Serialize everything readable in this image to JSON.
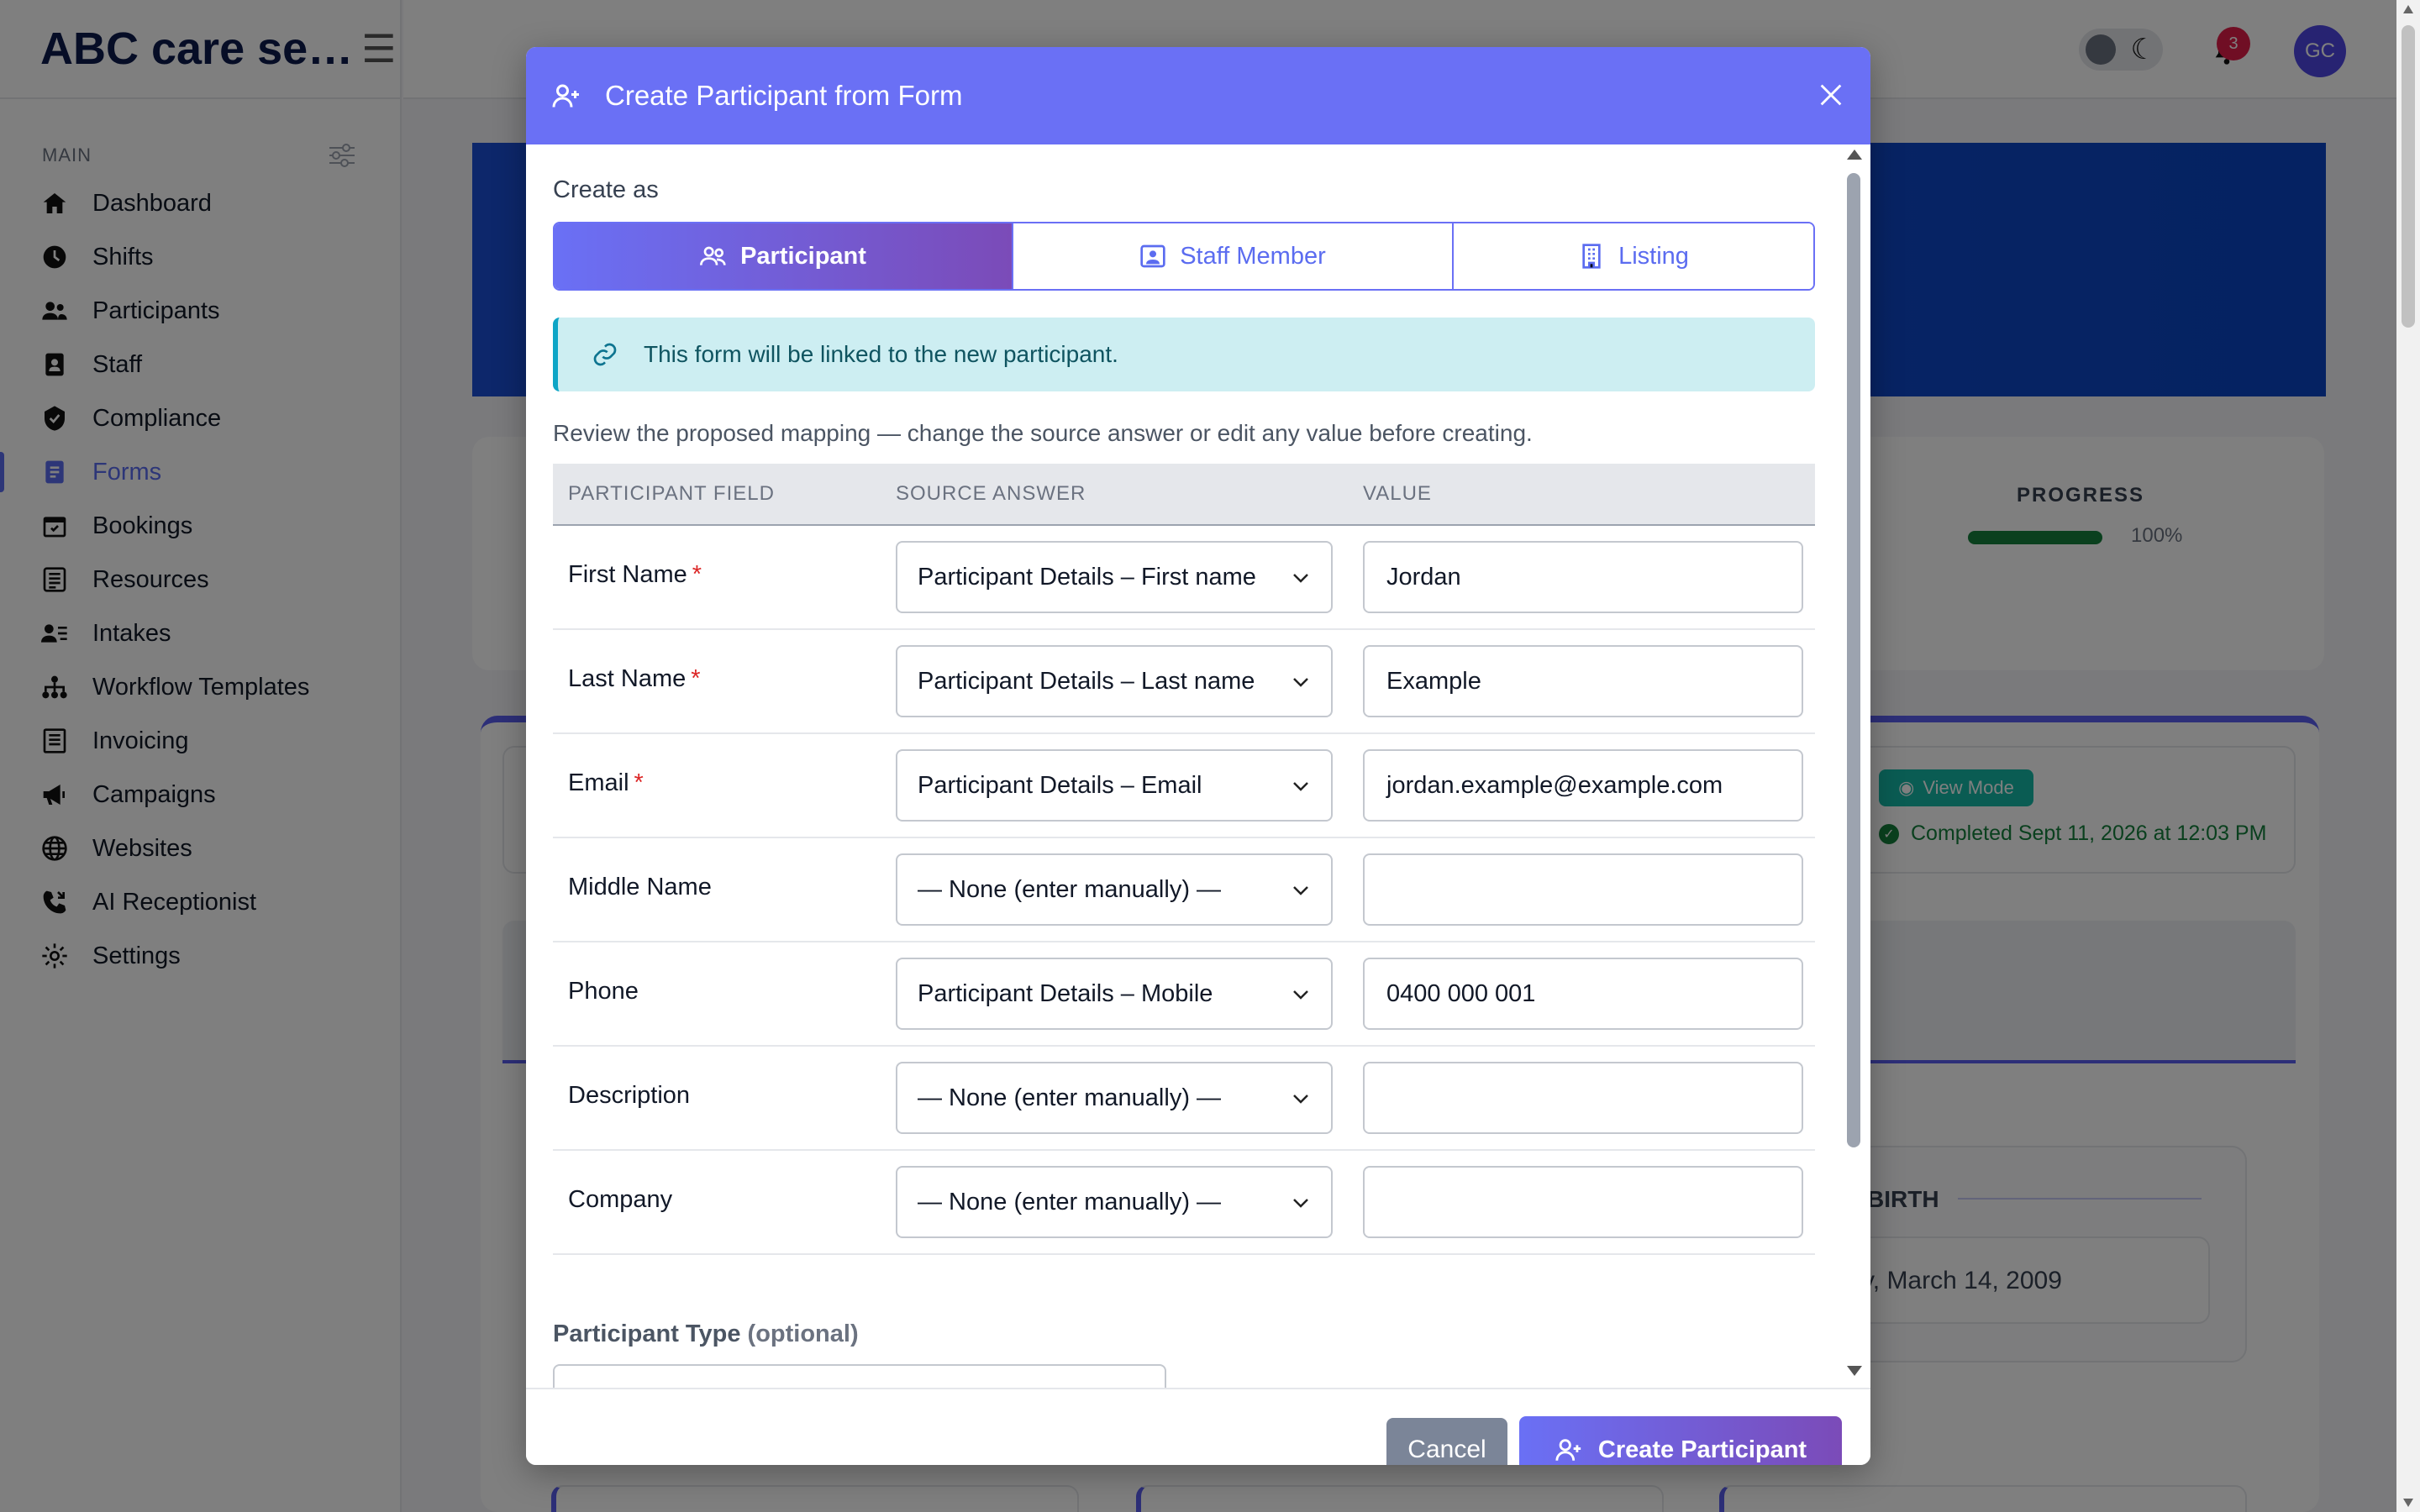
{
  "app": {
    "brand": "ABC care se…",
    "section_label": "MAIN",
    "nav": [
      {
        "label": "Dashboard",
        "icon": "home-icon"
      },
      {
        "label": "Shifts",
        "icon": "clock-icon"
      },
      {
        "label": "Participants",
        "icon": "users-icon"
      },
      {
        "label": "Staff",
        "icon": "id-badge-icon"
      },
      {
        "label": "Compliance",
        "icon": "shield-check-icon"
      },
      {
        "label": "Forms",
        "icon": "document-icon",
        "active": true
      },
      {
        "label": "Bookings",
        "icon": "calendar-icon"
      },
      {
        "label": "Resources",
        "icon": "list-icon"
      },
      {
        "label": "Intakes",
        "icon": "user-list-icon"
      },
      {
        "label": "Workflow Templates",
        "icon": "sitemap-icon"
      },
      {
        "label": "Invoicing",
        "icon": "invoice-icon"
      },
      {
        "label": "Campaigns",
        "icon": "megaphone-icon"
      },
      {
        "label": "Websites",
        "icon": "globe-icon"
      },
      {
        "label": "AI Receptionist",
        "icon": "phone-icon"
      },
      {
        "label": "Settings",
        "icon": "gear-icon"
      }
    ],
    "notifications_count": "3",
    "avatar_initials": "GC",
    "progress_label": "PROGRESS",
    "progress_pct": "100%",
    "progress_value": 1.0,
    "view_mode_label": "View Mode",
    "completed_text": "Completed Sept 11, 2026 at 12:03 PM",
    "dob_title": "BIRTH",
    "dob_value": "y, March 14, 2009"
  },
  "modal": {
    "title": "Create Participant from Form",
    "create_as_label": "Create as",
    "options": [
      {
        "label": "Participant",
        "icon": "users-icon",
        "active": true
      },
      {
        "label": "Staff Member",
        "icon": "staff-badge-icon",
        "active": false
      },
      {
        "label": "Listing",
        "icon": "building-icon",
        "active": false
      }
    ],
    "info_text": "This form will be linked to the new participant.",
    "hint": "Review the proposed mapping — change the source answer or edit any value before creating.",
    "columns": [
      "PARTICIPANT FIELD",
      "SOURCE ANSWER",
      "VALUE"
    ],
    "rows": [
      {
        "field": "First Name",
        "required": "*",
        "source": "Participant Details – First name",
        "value": "Jordan"
      },
      {
        "field": "Last Name",
        "required": "*",
        "source": "Participant Details – Last name",
        "value": "Example"
      },
      {
        "field": "Email",
        "required": "*",
        "source": "Participant Details – Email",
        "value": "jordan.example@example.com"
      },
      {
        "field": "Middle Name",
        "required": "",
        "source": "— None (enter manually) —",
        "value": ""
      },
      {
        "field": "Phone",
        "required": "",
        "source": "Participant Details – Mobile",
        "value": "0400 000 001"
      },
      {
        "field": "Description",
        "required": "",
        "source": "— None (enter manually) —",
        "value": ""
      },
      {
        "field": "Company",
        "required": "",
        "source": "— None (enter manually) —",
        "value": ""
      }
    ],
    "participant_type_label": "Participant Type",
    "participant_type_optional": "(optional)",
    "cancel_label": "Cancel",
    "create_label": "Create Participant"
  },
  "colors": {
    "accent": "#6a70f5",
    "accent_end": "#7b4bb8",
    "info_bg": "#cdeef2",
    "success": "#15803d",
    "required": "#dc2626"
  }
}
